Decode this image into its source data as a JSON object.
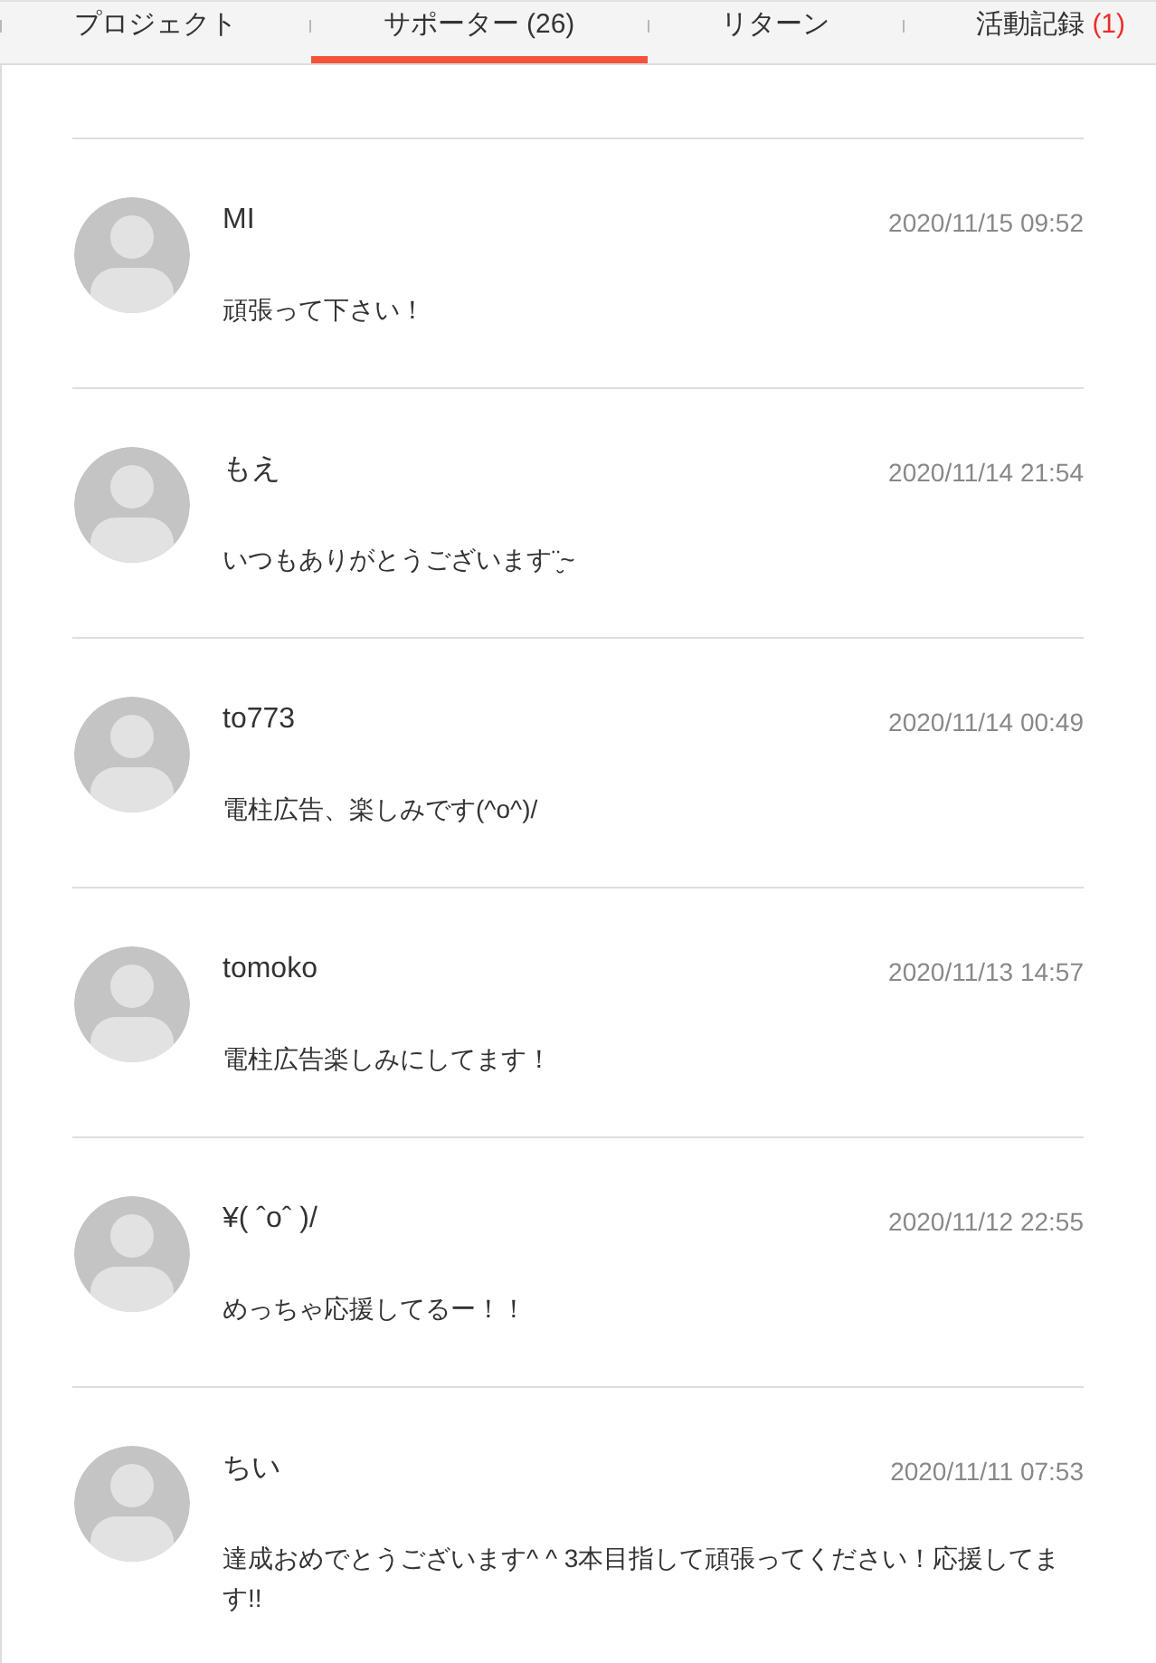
{
  "tabs": [
    {
      "label": "プロジェクト",
      "selected": false
    },
    {
      "label": "サポーター",
      "count": "(26)",
      "count_highlighted": false,
      "selected": true
    },
    {
      "label": "リターン",
      "selected": false
    },
    {
      "label": "活動記録",
      "count": "(1)",
      "count_highlighted": true,
      "selected": false
    }
  ],
  "supporters": [
    {
      "name": "MI",
      "date": "2020/11/15 09:52",
      "comment": "頑張って下さい！"
    },
    {
      "name": "もえ",
      "date": "2020/11/14 21:54",
      "comment": "いつもありがとうございます¨̮~"
    },
    {
      "name": "to773",
      "date": "2020/11/14 00:49",
      "comment": "電柱広告、楽しみです(^o^)/"
    },
    {
      "name": "tomoko",
      "date": "2020/11/13 14:57",
      "comment": "電柱広告楽しみにしてます！"
    },
    {
      "name": "¥( ˆoˆ )/",
      "date": "2020/11/12 22:55",
      "comment": "めっちゃ応援してるー！！"
    },
    {
      "name": "ちい",
      "date": "2020/11/11 07:53",
      "comment": "達成おめでとうございます^ ^ 3本目指して頑張ってください！応援してます!!"
    }
  ]
}
